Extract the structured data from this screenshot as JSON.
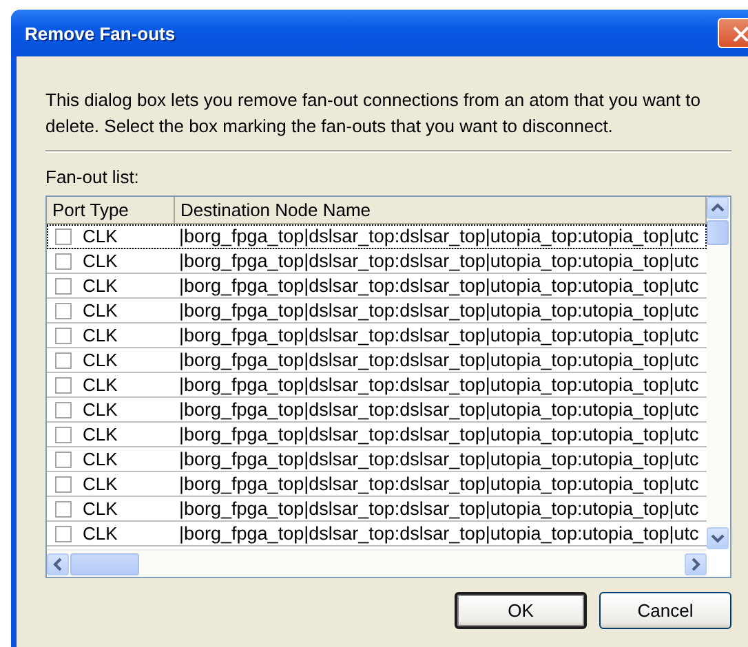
{
  "window": {
    "title": "Remove Fan-outs"
  },
  "description": "This dialog box lets you remove fan-out connections from an atom that you want to delete. Select the box marking the fan-outs that you want to disconnect.",
  "list_label": "Fan-out list:",
  "table": {
    "columns": [
      "Port Type",
      "Destination Node Name"
    ],
    "rows": [
      {
        "checked": false,
        "focused": true,
        "port_type": "CLK",
        "destination": "|borg_fpga_top|dslsar_top:dslsar_top|utopia_top:utopia_top|utc"
      },
      {
        "checked": false,
        "focused": false,
        "port_type": "CLK",
        "destination": "|borg_fpga_top|dslsar_top:dslsar_top|utopia_top:utopia_top|utc"
      },
      {
        "checked": false,
        "focused": false,
        "port_type": "CLK",
        "destination": "|borg_fpga_top|dslsar_top:dslsar_top|utopia_top:utopia_top|utc"
      },
      {
        "checked": false,
        "focused": false,
        "port_type": "CLK",
        "destination": "|borg_fpga_top|dslsar_top:dslsar_top|utopia_top:utopia_top|utc"
      },
      {
        "checked": false,
        "focused": false,
        "port_type": "CLK",
        "destination": "|borg_fpga_top|dslsar_top:dslsar_top|utopia_top:utopia_top|utc"
      },
      {
        "checked": false,
        "focused": false,
        "port_type": "CLK",
        "destination": "|borg_fpga_top|dslsar_top:dslsar_top|utopia_top:utopia_top|utc"
      },
      {
        "checked": false,
        "focused": false,
        "port_type": "CLK",
        "destination": "|borg_fpga_top|dslsar_top:dslsar_top|utopia_top:utopia_top|utc"
      },
      {
        "checked": false,
        "focused": false,
        "port_type": "CLK",
        "destination": "|borg_fpga_top|dslsar_top:dslsar_top|utopia_top:utopia_top|utc"
      },
      {
        "checked": false,
        "focused": false,
        "port_type": "CLK",
        "destination": "|borg_fpga_top|dslsar_top:dslsar_top|utopia_top:utopia_top|utc"
      },
      {
        "checked": false,
        "focused": false,
        "port_type": "CLK",
        "destination": "|borg_fpga_top|dslsar_top:dslsar_top|utopia_top:utopia_top|utc"
      },
      {
        "checked": false,
        "focused": false,
        "port_type": "CLK",
        "destination": "|borg_fpga_top|dslsar_top:dslsar_top|utopia_top:utopia_top|utc"
      },
      {
        "checked": false,
        "focused": false,
        "port_type": "CLK",
        "destination": "|borg_fpga_top|dslsar_top:dslsar_top|utopia_top:utopia_top|utc"
      },
      {
        "checked": false,
        "focused": false,
        "port_type": "CLK",
        "destination": "|borg_fpga_top|dslsar_top:dslsar_top|utopia_top:utopia_top|utc"
      }
    ]
  },
  "buttons": [
    "OK",
    "Cancel"
  ]
}
